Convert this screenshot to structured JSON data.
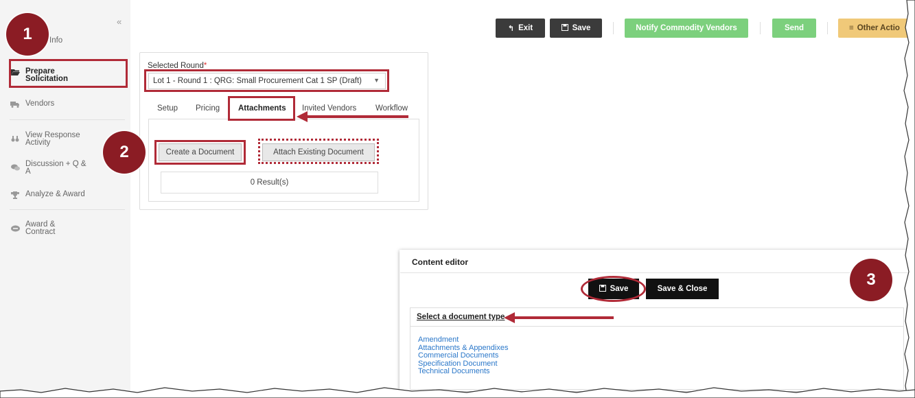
{
  "sidebar": {
    "collapse_label": "«",
    "items": [
      {
        "label": "Info",
        "icon": "info-icon"
      },
      {
        "label": "Prepare\nSolicitation",
        "line1": "Prepare",
        "line2": "Solicitation",
        "icon": "folder-open-icon"
      },
      {
        "label": "Vendors",
        "icon": "truck-icon"
      },
      {
        "line1": "View Response",
        "line2": "Activity",
        "icon": "binoculars-icon"
      },
      {
        "line1": "Discussion + Q &",
        "line2": "A",
        "icon": "comments-icon"
      },
      {
        "label": "Analyze & Award",
        "icon": "trophy-icon"
      },
      {
        "line1": "Award &",
        "line2": "Contract",
        "icon": "handshake-icon"
      }
    ]
  },
  "toolbar": {
    "exit_label": "Exit",
    "save_label": "Save",
    "notify_label": "Notify Commodity Vendors",
    "send_label": "Send",
    "other_label": "Other Actio"
  },
  "round": {
    "label": "Selected Round",
    "required_mark": "*",
    "value": "Lot 1 - Round 1 : QRG: Small Procurement Cat 1 SP (Draft)"
  },
  "tabs": [
    "Setup",
    "Pricing",
    "Attachments",
    "Invited Vendors",
    "Workflow"
  ],
  "attachments": {
    "create_label": "Create a Document",
    "attach_label": "Attach Existing Document",
    "results": "0 Result(s)"
  },
  "editor": {
    "title": "Content editor",
    "save_label": "Save",
    "save_close_label": "Save & Close",
    "doc_type_title": "Select a document type",
    "doc_types": [
      "Amendment",
      "Attachments & Appendixes",
      "Commercial Documents",
      "Specification Document",
      "Technical Documents"
    ]
  },
  "callouts": [
    "1",
    "2",
    "3"
  ],
  "colors": {
    "highlight": "#b02a37",
    "badge": "#8b1c24",
    "green": "#7cd07d",
    "yellow": "#f0c979",
    "link": "#2a77c9"
  }
}
